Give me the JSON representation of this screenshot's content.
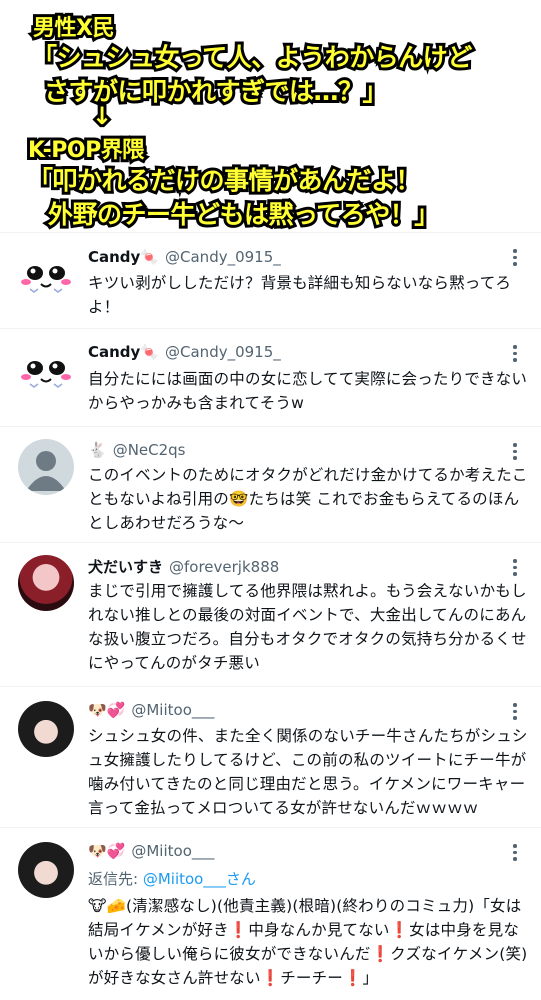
{
  "caption": {
    "line1": "男性X民",
    "line2": "「シュシュ女って人、ようわからんけど",
    "line3": "さすがに叩かれすぎでは…？」",
    "arrow": "↓",
    "line4": "K-POP界隈",
    "line5": "「叩かれるだけの事情があんだよ！",
    "line6": "外野のチー牛どもは黙ってろや！」"
  },
  "tweets": [
    {
      "name": "Candy🍬",
      "handle": "@Candy_0915_",
      "avatar_icon": "kawaii-face-avatar",
      "text": "キツい剥がししただけ？背景も詳細も知らないなら黙ってろよ！"
    },
    {
      "name": "Candy🍬",
      "handle": "@Candy_0915_",
      "avatar_icon": "kawaii-face-avatar",
      "text": "自分たにには画面の中の女に恋してて実際に会ったりできないからやっかみも含まれてそうw"
    },
    {
      "name": "🐇",
      "handle": "@NeC2qs",
      "avatar_icon": "default-person-avatar",
      "text": "このイベントのためにオタクがどれだけ金かけてるか考えたこともないよね引用の🤓たちは笑 これでお金もらえてるのほんとしあわせだろうな〜"
    },
    {
      "name": "犬だいすき",
      "handle": "@foreverjk888",
      "avatar_icon": "photo-avatar",
      "text": "まじで引用で擁護してる他界隈は黙れよ。もう会えないかもしれない推しとの最後の対面イベントで、大金出してんのにあんな扱い腹立つだろ。自分もオタクでオタクの気持ち分かるくせにやってんのがタチ悪い"
    },
    {
      "name": "🐶💞",
      "handle": "@Miitoo___",
      "avatar_icon": "photo-avatar",
      "text": "シュシュ女の件、また全く関係のないチー牛さんたちがシュシュ女擁護したりしてるけど、この前の私のツイートにチー牛が噛み付いてきたのと同じ理由だと思う。イケメンにワーキャー言って金払ってメロついてる女が許せないんだｗｗｗｗ"
    },
    {
      "name": "🐶💞",
      "handle": "@Miitoo___",
      "avatar_icon": "photo-avatar",
      "reply_prefix": "返信先: ",
      "reply_to": "@Miitoo___さん",
      "text": "🐮🧀(清潔感なし)(他責主義)(根暗)(終わりのコミュ力)「女は結局イケメンが好き❗中身なんか見てない❗女は中身を見ないから優しい俺らに彼女ができないんだ❗クズなイケメン(笑)が好きな女さん許せない❗チーチー❗」"
    }
  ],
  "colors": {
    "caption_fill": "#ffff33",
    "caption_stroke": "#000000",
    "handle": "#536471",
    "link": "#1d9bf0"
  }
}
